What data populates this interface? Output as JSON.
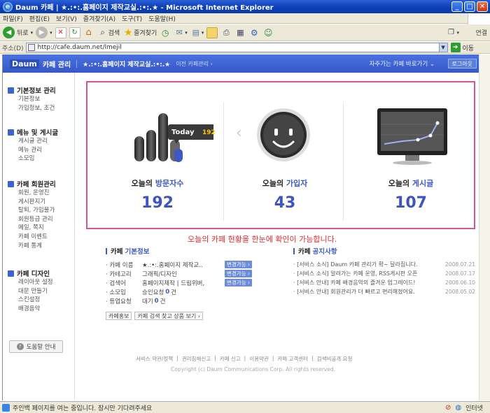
{
  "window": {
    "title": "Daum 카페 | ★.:•:.홈페이지 제작교실.:•:.★ - Microsoft Internet Explorer"
  },
  "menu": [
    "파일(F)",
    "편집(E)",
    "보기(V)",
    "즐겨찾기(A)",
    "도구(T)",
    "도움말(H)"
  ],
  "toolbar": {
    "back": "뒤로",
    "search": "검색",
    "favorites": "즐겨찾기",
    "links": "연결"
  },
  "address": {
    "label": "주소(D)",
    "url": "http://cafe.daum.net/lmejil",
    "go": "이동"
  },
  "header": {
    "logo": "Daum",
    "cafe_mgmt": "카페 관리",
    "cafe_name": "★.:•:.홈페이지 제작교실.:•:.★",
    "prev_mgmt": "이전 카페관리 ›",
    "shortcut": "자주가는 카페 바로가기 ⌄",
    "logout": "로그아웃"
  },
  "sidebar": [
    {
      "title": "기본정보 관리",
      "items": [
        "기본정보",
        "가입정보, 조건"
      ]
    },
    {
      "title": "메뉴 및 게시글",
      "items": [
        "게시글 관리",
        "메뉴 관리",
        "소모임"
      ]
    },
    {
      "title": "카페 회원관리",
      "items": [
        "회원, 운영진",
        "게시판지기",
        "탈퇴, 가입불가",
        "회원등급 관리",
        "메일, 쪽지",
        "카페 이벤트",
        "카페 통계"
      ]
    },
    {
      "title": "카페 디자인",
      "items": [
        "레이아웃 설정",
        "대문 만들기",
        "스킨설정",
        "배경음악"
      ]
    }
  ],
  "help": "도움말 안내",
  "stats": {
    "today_label": "Today",
    "today_value": "192",
    "visitors": {
      "label_prefix": "오늘의",
      "label_highlight": "방문자수",
      "value": "192"
    },
    "signups": {
      "label_prefix": "오늘의",
      "label_highlight": "가입자",
      "value": "43"
    },
    "posts": {
      "label_prefix": "오늘의",
      "label_highlight": "게시글",
      "value": "107"
    }
  },
  "caption": "오늘의 카페 현황을 한눈에 확인이 가능합니다.",
  "basic_info": {
    "title_prefix": "카페",
    "title_highlight": "기본정보",
    "rows": [
      {
        "key": "· 카페 이름",
        "value": "★.:•:.홈페이지 제작교..",
        "action": "변경가능 ›"
      },
      {
        "key": "· 카테고리",
        "value": "그래픽/디자인",
        "action": "변경가능 ›"
      },
      {
        "key": "· 검색어",
        "value": "홈페이지제작 | 드림위버,",
        "action": "변경가능 ›"
      },
      {
        "key": "· 소모임",
        "value_pre": "승인요청",
        "count": "0",
        "value_post": "건"
      },
      {
        "key": "· 등업요청",
        "value_pre": "대기",
        "count": "0",
        "value_post": "건"
      }
    ],
    "buttons": [
      "카페홍보",
      "카페 검색 찾고 상품 보기 ›"
    ]
  },
  "notices": {
    "title_prefix": "카페",
    "title_highlight": "공지사항",
    "items": [
      {
        "text": "· [서비스 소식] Daum 카페 관리가 확~ 달라집니다.",
        "date": "2008.07.21"
      },
      {
        "text": "· [서비스 소식] 알려가는 카페 운영, RSS게시판 오픈",
        "date": "2008.07.17"
      },
      {
        "text": "· [서비스 안내] 카페 배경음악의 즐겨운 업그레이드!",
        "date": "2008.06.10"
      },
      {
        "text": "· [서비스 안내] 회원관리가 더 빠르고 편리해졌어요.",
        "date": "2008.05.02"
      }
    ]
  },
  "footer": {
    "links": [
      "서비스 약관/정책",
      "|",
      "권리침해신고",
      "|",
      "카페 신고",
      "|",
      "이용약관",
      "|",
      "카페 고객센터",
      "|",
      "검색비공개 요청"
    ],
    "copyright": "Copyright (c) Daum Communications Corp. All rights reserved."
  },
  "status": {
    "text": "주인백 페이지를 여는 중입니다. 잠시만 기다려주세요",
    "zone": "인터넷"
  }
}
